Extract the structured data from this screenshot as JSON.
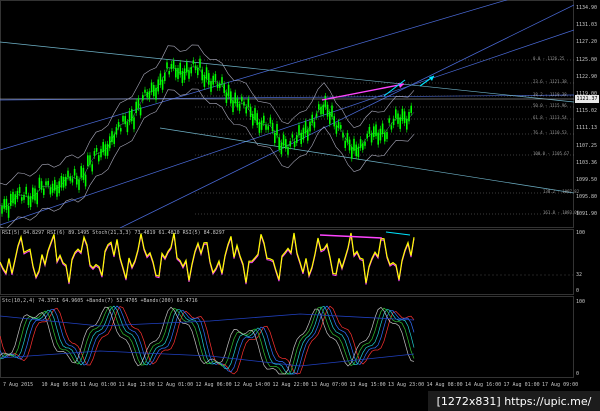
{
  "main": {
    "price_axis": [
      "1134.90",
      "1131.03",
      "1127.20",
      "1125.00",
      "1122.90",
      "1119.00",
      "1115.02",
      "1111.13",
      "1107.25",
      "1103.36",
      "1099.50",
      "1095.80",
      "1091.90"
    ],
    "current_price": "1121.37",
    "fibo_levels": [
      "0.0 - 1126.25",
      "23.6 - 1121.38",
      "38.2 - 1118.38",
      "50.0 - 1115.96",
      "61.8 - 1113.54",
      "76.4 - 1110.53",
      "100.0 - 1105.67",
      "138.2 - 1097.82",
      "161.8 - 1093.00"
    ]
  },
  "rsi": {
    "title": "RSI(5) 84.8297  RSI(6) 89.1495  Stoch(21,3,3) 73.4819 61.4810  RSI(5) 84.8297",
    "axis": [
      "100",
      "32",
      "0"
    ]
  },
  "osc": {
    "title": "Stc(10,2,4) 74.3751 64.9605  +Bands(7) 53.4705  +Bands(200) 63.4716",
    "axis": [
      "100",
      "0"
    ]
  },
  "time_axis": [
    "7 Aug 2015",
    "10 Aug 05:00",
    "11 Aug 01:00",
    "11 Aug 13:00",
    "12 Aug 01:00",
    "12 Aug 06:00",
    "12 Aug 14:00",
    "12 Aug 22:00",
    "13 Aug 07:00",
    "13 Aug 15:00",
    "13 Aug 23:00",
    "14 Aug 08:00",
    "14 Aug 16:00",
    "17 Aug 01:00",
    "17 Aug 09:00"
  ],
  "watermark": "[1272x831] https://upic.me/",
  "colors": {
    "candles": "#00ff00",
    "trend_lines": "#4a6ad8",
    "channel_lines": "#6fb3c9",
    "magenta_arrow": "#ff44ff",
    "cyan_arrow": "#00e5ff",
    "rsi_line": "#ffff00"
  }
}
